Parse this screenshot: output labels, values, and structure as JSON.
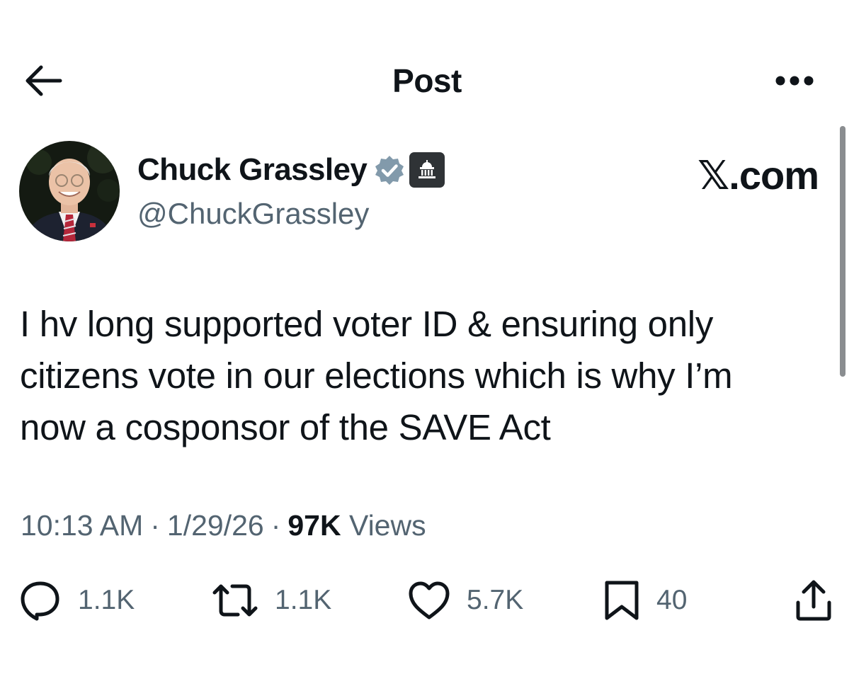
{
  "header": {
    "title": "Post",
    "back_icon": "arrow-left-icon",
    "more_icon": "more-horizontal-icon"
  },
  "author": {
    "display_name": "Chuck Grassley",
    "handle": "@ChuckGrassley",
    "verified_icon": "verified-badge-icon",
    "verified_color": "#829aab",
    "affiliation_icon": "government-building-icon"
  },
  "watermark": "𝕏.com",
  "tweet": {
    "text": "I hv long supported voter ID & ensuring only\ncitizens vote in our elections which is why I’m\nnow a cosponsor of the SAVE Act"
  },
  "meta": {
    "time": "10:13 AM",
    "date": "1/29/26",
    "views_count": "97K",
    "views_label": "Views"
  },
  "actions": {
    "replies": "1.1K",
    "reposts": "1.1K",
    "likes": "5.7K",
    "bookmarks": "40"
  },
  "colors": {
    "text": "#0f1419",
    "secondary": "#536471",
    "icon": "#536471"
  }
}
